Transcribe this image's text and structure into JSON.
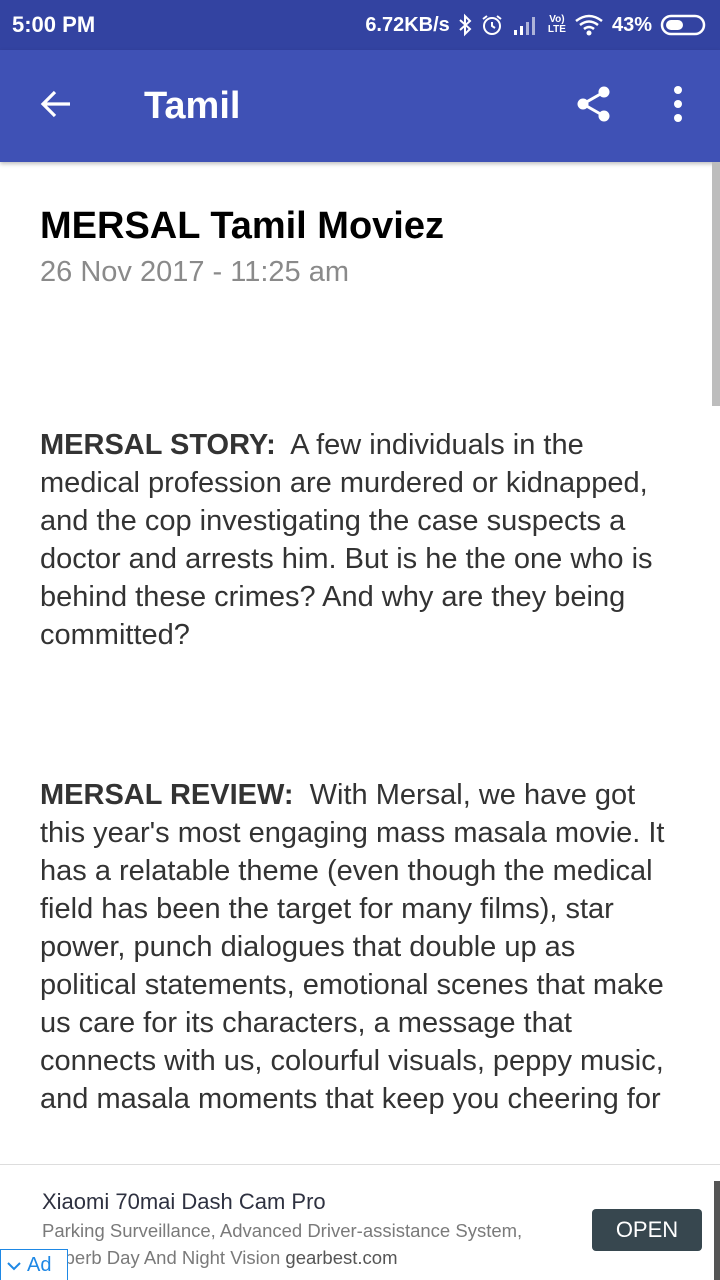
{
  "status_bar": {
    "time": "5:00 PM",
    "speed": "6.72KB/s",
    "battery": "43%",
    "icons": [
      "bluetooth-icon",
      "alarm-icon",
      "signal-icon",
      "volte-icon",
      "wifi-icon",
      "battery-icon"
    ],
    "volte_label_1": "Vo)",
    "volte_label_2": "LTE"
  },
  "app_bar": {
    "title": "Tamil",
    "icons": [
      "back-arrow-icon",
      "share-icon",
      "more-vert-icon"
    ]
  },
  "article": {
    "title": "MERSAL Tamil Moviez",
    "date": "26 Nov 2017 - 11:25 am",
    "paragraphs": [
      {
        "lead": "MERSAL STORY:",
        "text": "A few individuals in the medical profession are murdered or kidnapped, and the cop investigating the case suspects a doctor and arrests him. But is he the one who is behind these crimes? And why are they being committed?"
      },
      {
        "lead": "MERSAL REVIEW:",
        "text": "With Mersal, we have got this year's most engaging mass masala movie. It has a relatable theme (even though the medical field has been the target for many films), star power, punch dialogues that double up as political statements, emotional scenes that make us care for its characters, a message that connects with us, colourful visuals, peppy music, and masala moments that keep you cheering for"
      }
    ]
  },
  "ad": {
    "title": "Xiaomi 70mai Dash Cam Pro",
    "description": "Parking Surveillance, Advanced Driver-assistance System, Superb Day And Night Vision",
    "domain": "gearbest.com",
    "button": "OPEN",
    "badge": "Ad"
  },
  "colors": {
    "status_bar": "#3343a1",
    "app_bar": "#3f51b5",
    "ad_button": "#37474f",
    "ad_badge": "#1e88e5"
  }
}
